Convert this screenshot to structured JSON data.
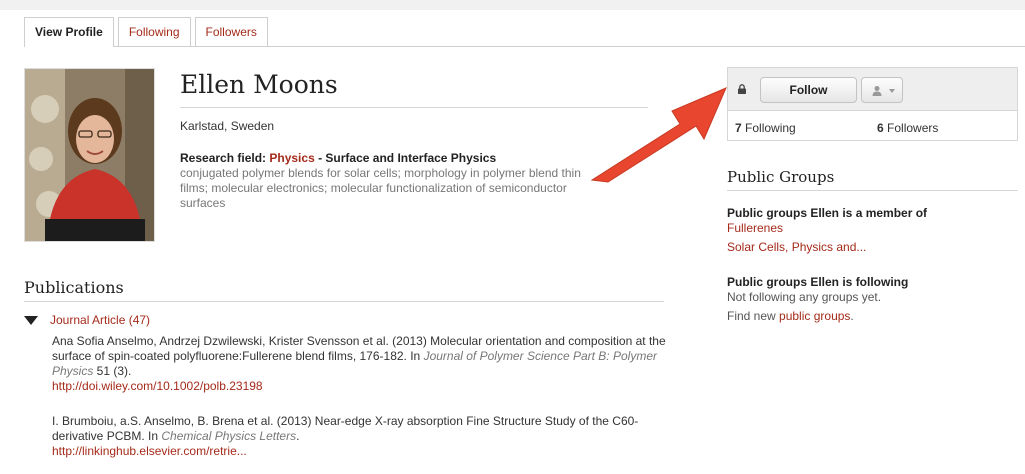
{
  "tabs": [
    {
      "label": "View Profile",
      "active": true
    },
    {
      "label": "Following",
      "active": false
    },
    {
      "label": "Followers",
      "active": false
    }
  ],
  "profile": {
    "name": "Ellen Moons",
    "location": "Karlstad, Sweden",
    "research_prefix": "Research field: ",
    "research_field": "Physics",
    "research_sub": " - Surface and Interface Physics",
    "research_desc": "conjugated polymer blends for solar cells; morphology in polymer blend thin films; molecular electronics; molecular functionalization of semiconductor surfaces"
  },
  "publications": {
    "heading": "Publications",
    "group_label": "Journal Article (47)",
    "items": [
      {
        "text": "Ana Sofia Anselmo, Andrzej Dzwilewski, Krister Svensson et al. (2013) Molecular orientation and composition at the surface of spin-coated polyfluorene:Fullerene blend films, 176-182. In ",
        "journal": "Journal of Polymer Science Part B: Polymer Physics",
        "suffix": " 51 (3).",
        "link": "http://doi.wiley.com/10.1002/polb.23198"
      },
      {
        "text": "I. Brumboiu, a.S. Anselmo, B. Brena et al. (2013) Near-edge X-ray absorption Fine Structure Study of the C60-derivative PCBM. In ",
        "journal": "Chemical Physics Letters",
        "suffix": ".",
        "link": "http://linkinghub.elsevier.com/retrie..."
      }
    ]
  },
  "follow": {
    "button_label": "Follow",
    "following_count": "7",
    "following_label": " Following",
    "followers_count": "6",
    "followers_label": " Followers"
  },
  "groups": {
    "heading": "Public Groups",
    "member_heading": "Public groups Ellen is a member of",
    "member_items": [
      "Fullerenes",
      "Solar Cells, Physics and..."
    ],
    "following_heading": "Public groups Ellen is following",
    "following_empty": "Not following any groups yet.",
    "find_prefix": "Find new ",
    "find_link": "public groups",
    "find_suffix": "."
  },
  "icons": {
    "lock": "lock-icon",
    "person": "person-icon",
    "caret": "chevron-down-icon",
    "triangle": "triangle-down-icon"
  },
  "colors": {
    "accent": "#a52a1a",
    "arrow": "#e8462e"
  }
}
